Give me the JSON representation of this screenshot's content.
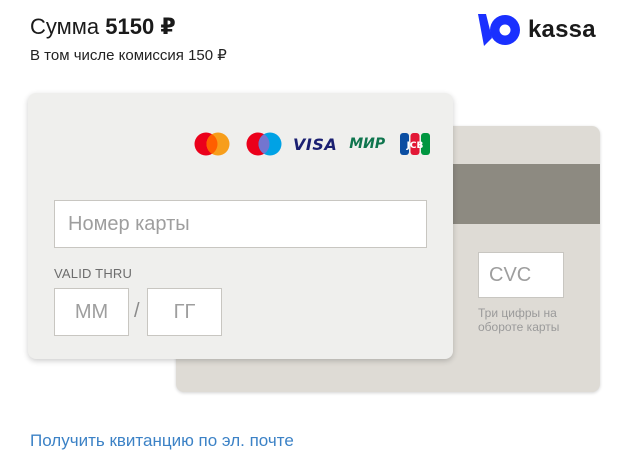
{
  "payment": {
    "sum_label": "Сумма",
    "amount": "5150 ₽",
    "commission_text": "В том числе комиссия 150 ₽"
  },
  "logo": {
    "text": "kassa",
    "icon": "yoo-kassa-logo-icon",
    "brand_color": "#1a30ff"
  },
  "card_front": {
    "brands": [
      "mastercard-icon",
      "maestro-icon",
      "VISA",
      "МИР",
      "jcb-icon"
    ],
    "visa_text": "VISA",
    "mir_text": "МИР",
    "number_placeholder": "Номер карты",
    "valid_thru_label": "VALID THRU",
    "month_placeholder": "ММ",
    "year_placeholder": "ГГ",
    "separator": "/"
  },
  "card_back": {
    "cvc_placeholder": "CVC",
    "cvc_hint": "Три цифры на обороте карты"
  },
  "receipt_link": "Получить квитанцию по эл. почте",
  "colors": {
    "link": "#3c82c6",
    "card_front_bg": "#efefed",
    "card_back_bg": "#dedbd5",
    "magstripe": "#8d8a81",
    "visa": "#1a1f71",
    "mir": "#0f754e"
  }
}
